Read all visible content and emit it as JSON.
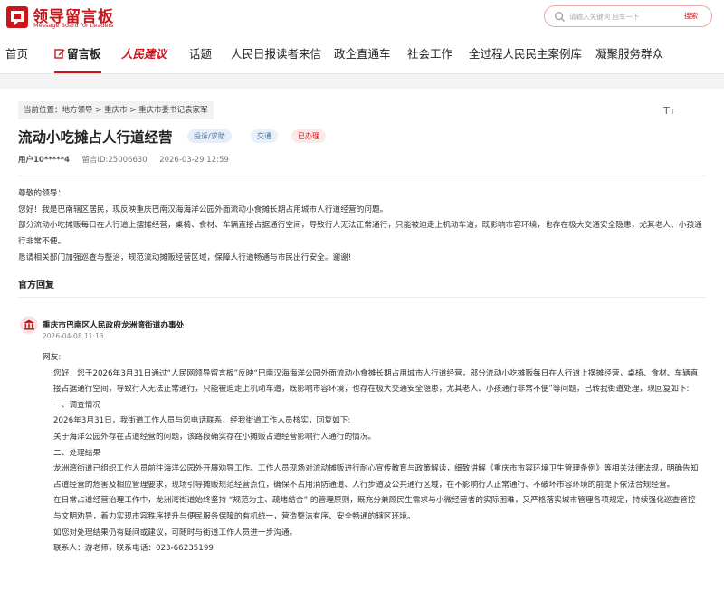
{
  "header": {
    "logo_title": "领导留言板",
    "logo_subtitle": "Message Board for Leaders",
    "search_placeholder": "请输入关键词 回车一下",
    "search_button": "搜索"
  },
  "nav": {
    "items": [
      "首页",
      "留言板",
      "人民建议",
      "话题",
      "人民日报读者来信",
      "政企直通车",
      "社会工作",
      "全过程人民民主案例库",
      "凝聚服务群众"
    ],
    "active_index": 1
  },
  "breadcrumb": {
    "prefix": "当前位置：",
    "items": [
      "地方领导",
      "重庆市",
      "重庆市委书记袁家军"
    ],
    "separator": " > "
  },
  "font_size_icon": "Tт",
  "message": {
    "title": "流动小吃摊占人行道经营",
    "tags": {
      "category": "投诉/求助",
      "field": "交通",
      "status": "已办理"
    },
    "user": "用户10*****4",
    "id_text": "留言ID:25006630",
    "date": "2026-03-29 12:59",
    "body": [
      "尊敬的领导：",
      "您好！我是巴南辖区居民，现反映重庆巴南汉海海洋公园外面流动小食摊长期占用城市人行道经营的问题。",
      "部分流动小吃摊贩每日在人行道上摆摊经营，桌椅、食材、车辆直接占据通行空间，导致行人无法正常通行，只能被迫走上机动车道，既影响市容环境，也存在极大交通安全隐患，尤其老人、小孩通行非常不便。",
      "恳请相关部门加强巡查与整治，规范流动摊贩经营区域，保障人行道畅通与市民出行安全。谢谢!"
    ]
  },
  "reply": {
    "heading": "官方回复",
    "org": "重庆市巴南区人民政府龙洲湾街道办事处",
    "date": "2026-04-08 11:13",
    "body": [
      "网友:",
      "您好！您于2026年3月31日通过“人民网领导留言板”反映“巴南汉海海洋公园外面流动小食摊长期占用城市人行道经营，部分流动小吃摊贩每日在人行道上摆摊经营，桌椅、食材、车辆直接占据通行空间，导致行人无法正常通行，只能被迫走上机动车道，既影响市容环境，也存在极大交通安全隐患，尤其老人、小孩通行非常不便”等问题，已转我街道处理，现回复如下:",
      "一、调查情况",
      "2026年3月31日，我街道工作人员与您电话联系，经我街道工作人员核实，回复如下:",
      "关于海洋公园外存在占道经营的问题，该路段确实存在小摊贩占道经营影响行人通行的情况。",
      "二、处理结果",
      "龙洲湾街道已组织工作人员前往海洋公园外开展劝导工作。工作人员现场对流动摊贩进行耐心宣传教育与政策解读，细致讲解《重庆市市容环境卫生管理条例》等相关法律法规，明确告知占道经营的危害及相应管理要求，现场引导摊贩规范经营点位，确保不占用消防通道、人行步道及公共通行区域，在不影响行人正常通行、不破坏市容环境的前提下依法合规经营。",
      "在日常占道经营治理工作中，龙洲湾街道始终坚持 “规范为主、疏堵结合” 的管理原则，既充分兼顾民生需求与小微经营者的实际困难，又严格落实城市管理各项规定，持续强化巡查管控与文明劝导，着力实现市容秩序提升与便民服务保障的有机统一，营造整洁有序、安全畅通的辖区环境。",
      "如您对处理结果仍有疑问或建议，可随时与街道工作人员进一步沟通。",
      "联系人：游老师，联系电话：023-66235199"
    ]
  },
  "colors": {
    "brand": "#c8161d",
    "tag_blue": "#4a6fa5",
    "tag_red_bg": "#fbe9ea"
  }
}
